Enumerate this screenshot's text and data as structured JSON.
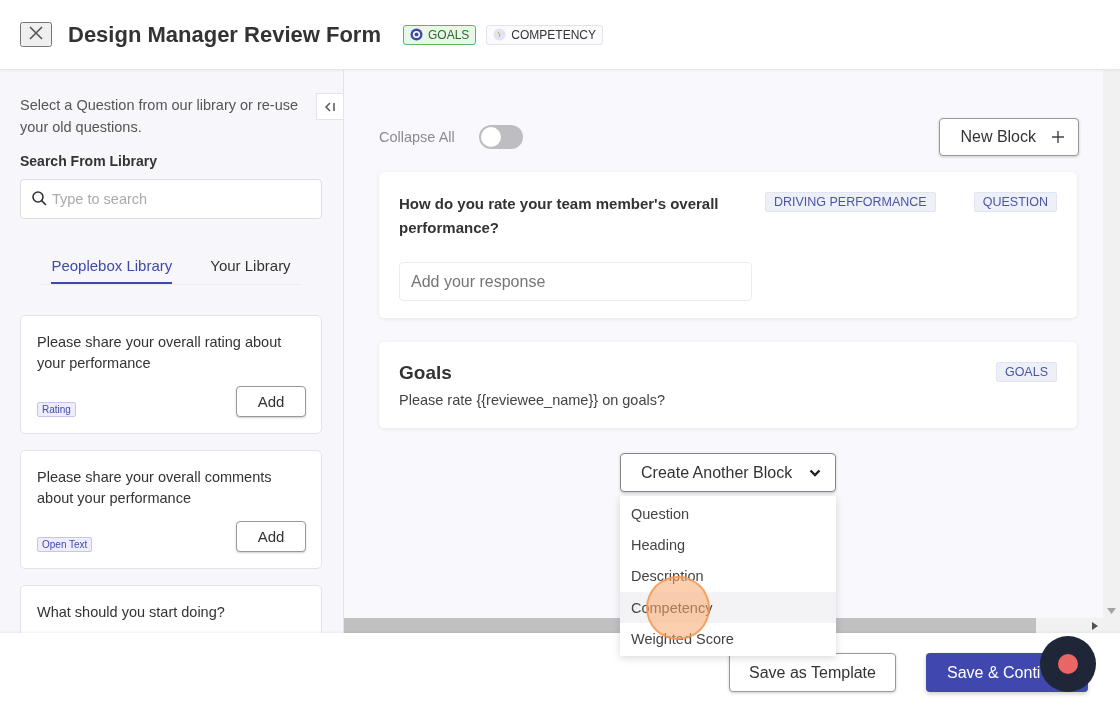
{
  "header": {
    "title": "Design Manager Review Form",
    "tags": [
      {
        "label": "GOALS",
        "kind": "goals"
      },
      {
        "label": "COMPETENCY",
        "kind": "competency"
      }
    ]
  },
  "sidebar": {
    "intro": "Select a Question from our library or re-use your old questions.",
    "search_label": "Search From Library",
    "search": {
      "placeholder": "Type to search"
    },
    "tabs": [
      {
        "label": "Peoplebox Library",
        "selected": true
      },
      {
        "label": "Your Library",
        "selected": false
      }
    ],
    "cards": [
      {
        "text": "Please share your overall rating about your performance",
        "tag": "Rating",
        "button": "Add"
      },
      {
        "text": "Please share your overall comments about your performance",
        "tag": "Open Text",
        "button": "Add"
      },
      {
        "text": "What should you start doing?"
      }
    ]
  },
  "main": {
    "collapse_all": {
      "label": "Collapse All",
      "on": false
    },
    "new_block": "New Block",
    "blocks": [
      {
        "kind": "question",
        "title": "How do you rate your team member's overall performance?",
        "tags": [
          "DRIVING PERFORMANCE",
          "QUESTION"
        ],
        "response": {
          "placeholder": "Add your response"
        }
      },
      {
        "kind": "section",
        "title": "Goals",
        "tags": [
          "GOALS"
        ],
        "description": "Please rate {{reviewee_name}} on goals?"
      }
    ],
    "create_block": {
      "label": "Create Another Block",
      "expanded": true,
      "options": [
        {
          "label": "Question",
          "selected": false
        },
        {
          "label": "Heading",
          "selected": false
        },
        {
          "label": "Description",
          "selected": false
        },
        {
          "label": "Competency",
          "selected": true
        },
        {
          "label": "Weighted Score",
          "selected": false
        }
      ]
    }
  },
  "footer": {
    "buttons": [
      {
        "label": "Save as Template",
        "kind": "secondary"
      },
      {
        "label": "Save & Conti",
        "kind": "primary"
      }
    ]
  }
}
